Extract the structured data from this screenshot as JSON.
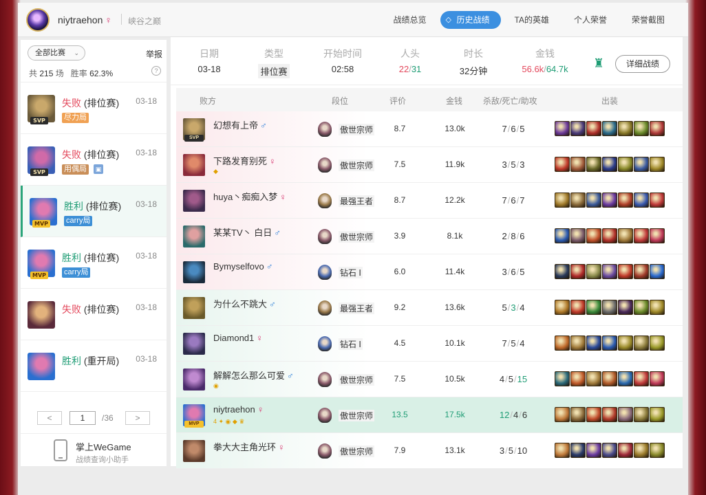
{
  "header": {
    "username": "niytraehon",
    "gender_symbol": "♀",
    "server": "峡谷之巅",
    "tabs": [
      "战绩总览",
      "历史战绩",
      "TA的英雄",
      "个人荣誉",
      "荣誉截图"
    ],
    "active_tab": "历史战绩"
  },
  "sidebar": {
    "filter_label": "全部比赛",
    "report_label": "举报",
    "summary_prefix": "共",
    "total_games": "215",
    "games_unit": "场",
    "winrate_label": "胜率",
    "winrate": "62.3%",
    "help": "?",
    "matches": [
      {
        "result": "失败",
        "mode": "(排位赛)",
        "date": "03-18",
        "badge": "SVP",
        "tag": "尽力局",
        "tag_color": "orange",
        "icon_colors": [
          "#6a5a3a",
          "#c9a86b"
        ]
      },
      {
        "result": "失败",
        "mode": "(排位赛)",
        "date": "03-18",
        "badge": "SVP",
        "tag": "用偶局",
        "tag_color": "brown",
        "extra_icon": true,
        "icon_colors": [
          "#3a5fb6",
          "#d06aa8"
        ]
      },
      {
        "result": "胜利",
        "mode": "(排位赛)",
        "date": "03-18",
        "badge": "MVP",
        "tag": "carry局",
        "tag_color": "blue",
        "icon_colors": [
          "#2a6fd0",
          "#e07ab0"
        ]
      },
      {
        "result": "胜利",
        "mode": "(排位赛)",
        "date": "03-18",
        "badge": "MVP",
        "tag": "carry局",
        "tag_color": "blue",
        "icon_colors": [
          "#2a6fd0",
          "#e07ab0"
        ]
      },
      {
        "result": "失败",
        "mode": "(排位赛)",
        "date": "03-18",
        "badge": "",
        "tag": "",
        "icon_colors": [
          "#5a2a3a",
          "#e2b27c"
        ]
      },
      {
        "result": "胜利",
        "mode": "(重开局)",
        "date": "03-18",
        "badge": "",
        "tag": "",
        "icon_colors": [
          "#2a6fd0",
          "#e07ab0"
        ]
      }
    ],
    "pager": {
      "prev": "<",
      "current": "1",
      "total": "/36",
      "next": ">"
    },
    "wegame": {
      "title": "掌上WeGame",
      "subtitle": "战绩查询小助手"
    }
  },
  "match_header": {
    "date_label": "日期",
    "date": "03-18",
    "type_label": "类型",
    "type": "排位赛",
    "start_label": "开始时间",
    "start": "02:58",
    "kills_label": "人头",
    "kills_red": "22",
    "kills_green": "31",
    "duration_label": "时长",
    "duration": "32分钟",
    "gold_label": "金钱",
    "gold_red": "56.6k",
    "gold_green": "64.7k",
    "detail_button": "详细战绩"
  },
  "table": {
    "headers": {
      "team": "败方",
      "rank": "段位",
      "score": "评价",
      "gold": "金钱",
      "kda": "杀敌/死亡/助攻",
      "items": "出装"
    },
    "rows": [
      {
        "name": "幻想有上帝",
        "gender": "♂",
        "gender_type": "m",
        "rank": "傲世宗师",
        "score": "8.7",
        "gold": "13.0k",
        "k": "7",
        "d": "6",
        "a": "5",
        "side": "lose",
        "badge": "SVP",
        "sub": "",
        "icon_colors": [
          "#6a5a3a",
          "#c9a86b"
        ],
        "rank_color": "#8a5a6a",
        "items": [
          "#6d3a9a",
          "#4a3a7a",
          "#b0302a",
          "#2a6a8a",
          "#8a7a2a",
          "#6a8a2a",
          "#b03a3a"
        ]
      },
      {
        "name": "下路发育别死",
        "gender": "♀",
        "gender_type": "f",
        "rank": "傲世宗师",
        "score": "7.5",
        "gold": "11.9k",
        "k": "3",
        "d": "5",
        "a": "3",
        "side": "lose",
        "badge": "",
        "sub": "◆",
        "icon_colors": [
          "#8a2a3a",
          "#e08a6a"
        ],
        "rank_color": "#8a5a6a",
        "items": [
          "#c03a2a",
          "#a05a3a",
          "#6a6a2a",
          "#2a3a8a",
          "#8a8a2a",
          "#3a5aa0",
          "#a08a2a"
        ]
      },
      {
        "name": "huya丶痴痴入梦",
        "gender": "♀",
        "gender_type": "f",
        "rank": "最强王者",
        "score": "8.7",
        "gold": "12.2k",
        "k": "7",
        "d": "6",
        "a": "7",
        "side": "lose",
        "badge": "",
        "sub": "",
        "icon_colors": [
          "#3a2a4a",
          "#a05a8a"
        ],
        "rank_color": "#9a7a4a",
        "items": [
          "#a07a2a",
          "#8a6a3a",
          "#3a5a9a",
          "#6a3aa0",
          "#b0402a",
          "#3a5ab0",
          "#c03a3a"
        ]
      },
      {
        "name": "某某TV丶 白日",
        "gender": "♂",
        "gender_type": "m",
        "rank": "傲世宗师",
        "score": "3.9",
        "gold": "8.1k",
        "k": "2",
        "d": "8",
        "a": "6",
        "side": "lose",
        "badge": "",
        "sub": "",
        "icon_colors": [
          "#2a6a6a",
          "#e0a0a0"
        ],
        "rank_color": "#8a5a6a",
        "items": [
          "#2a5ab0",
          "#7a5a6a",
          "#c0502a",
          "#b0302a",
          "#a07a3a",
          "#c03a3a",
          "#c03a5a"
        ]
      },
      {
        "name": "Bymyselfovo",
        "gender": "♂",
        "gender_type": "m",
        "rank": "钻石 Ⅰ",
        "score": "6.0",
        "gold": "11.4k",
        "k": "3",
        "d": "6",
        "a": "5",
        "side": "lose",
        "badge": "",
        "sub": "",
        "icon_colors": [
          "#1a2a3a",
          "#4a8ac0"
        ],
        "rank_color": "#4a6ab0",
        "items": [
          "#2a3a5a",
          "#b02a2a",
          "#8a8a4a",
          "#6a4aa0",
          "#c03a2a",
          "#a03a2a",
          "#2a6ad0"
        ]
      },
      {
        "name": "为什么不跳大",
        "gender": "♂",
        "gender_type": "m",
        "rank": "最强王者",
        "score": "9.2",
        "gold": "13.6k",
        "k": "5",
        "d": "3",
        "a": "4",
        "side": "win",
        "badge": "",
        "sub": "",
        "icon_colors": [
          "#6a5a2a",
          "#c0a05a"
        ],
        "rank_color": "#9a7a4a",
        "items": [
          "#b07a2a",
          "#c03a2a",
          "#3a8a3a",
          "#6a6a6a",
          "#4a2a5a",
          "#6a8a2a",
          "#a08a2a"
        ]
      },
      {
        "name": "Diamond1",
        "gender": "♀",
        "gender_type": "f",
        "rank": "钻石 Ⅰ",
        "score": "4.5",
        "gold": "10.1k",
        "k": "7",
        "d": "5",
        "a": "4",
        "side": "win",
        "badge": "",
        "sub": "",
        "icon_colors": [
          "#2a2a4a",
          "#9a7ac0"
        ],
        "rank_color": "#4a6ab0",
        "items": [
          "#c06a2a",
          "#a07a3a",
          "#2a4a9a",
          "#2a5ab0",
          "#9a8a2a",
          "#8a7a3a",
          "#9a9a2a"
        ]
      },
      {
        "name": "解解怎么那么可爱",
        "gender": "♂",
        "gender_type": "m",
        "rank": "傲世宗师",
        "score": "7.5",
        "gold": "10.5k",
        "k": "4",
        "d": "5",
        "a": "15",
        "side": "win",
        "badge": "",
        "sub": "◉",
        "icon_colors": [
          "#4a2a6a",
          "#c08ad0"
        ],
        "rank_color": "#8a5a6a",
        "items": [
          "#2a6a7a",
          "#c05a2a",
          "#a07a3a",
          "#b05a2a",
          "#2a6ab0",
          "#c03a3a",
          "#c03a5a"
        ]
      },
      {
        "name": "niytraehon",
        "gender": "♀",
        "gender_type": "f",
        "rank": "傲世宗师",
        "score": "13.5",
        "gold": "17.5k",
        "k": "12",
        "d": "4",
        "a": "6",
        "side": "self",
        "badge": "MVP",
        "sub": "4 ✦ ◉ ◆ ♛",
        "icon_colors": [
          "#2a6fd0",
          "#e07ab0"
        ],
        "rank_color": "#8a5a6a",
        "items": [
          "#c07a3a",
          "#8a6a3a",
          "#c04a2a",
          "#b03a2a",
          "#8a6a7a",
          "#8a7a3a",
          "#9a9a2a"
        ]
      },
      {
        "name": "拳大大主角光环",
        "gender": "♀",
        "gender_type": "f",
        "rank": "傲世宗师",
        "score": "7.9",
        "gold": "13.1k",
        "k": "3",
        "d": "5",
        "a": "10",
        "side": "win",
        "badge": "",
        "sub": "",
        "icon_colors": [
          "#5a3a2a",
          "#c08a6a"
        ],
        "rank_color": "#8a5a6a",
        "items": [
          "#c07a3a",
          "#2a3a6a",
          "#6a3aa0",
          "#4a4a8a",
          "#a02a3a",
          "#9a7a2a",
          "#8a8a2a"
        ]
      }
    ]
  }
}
